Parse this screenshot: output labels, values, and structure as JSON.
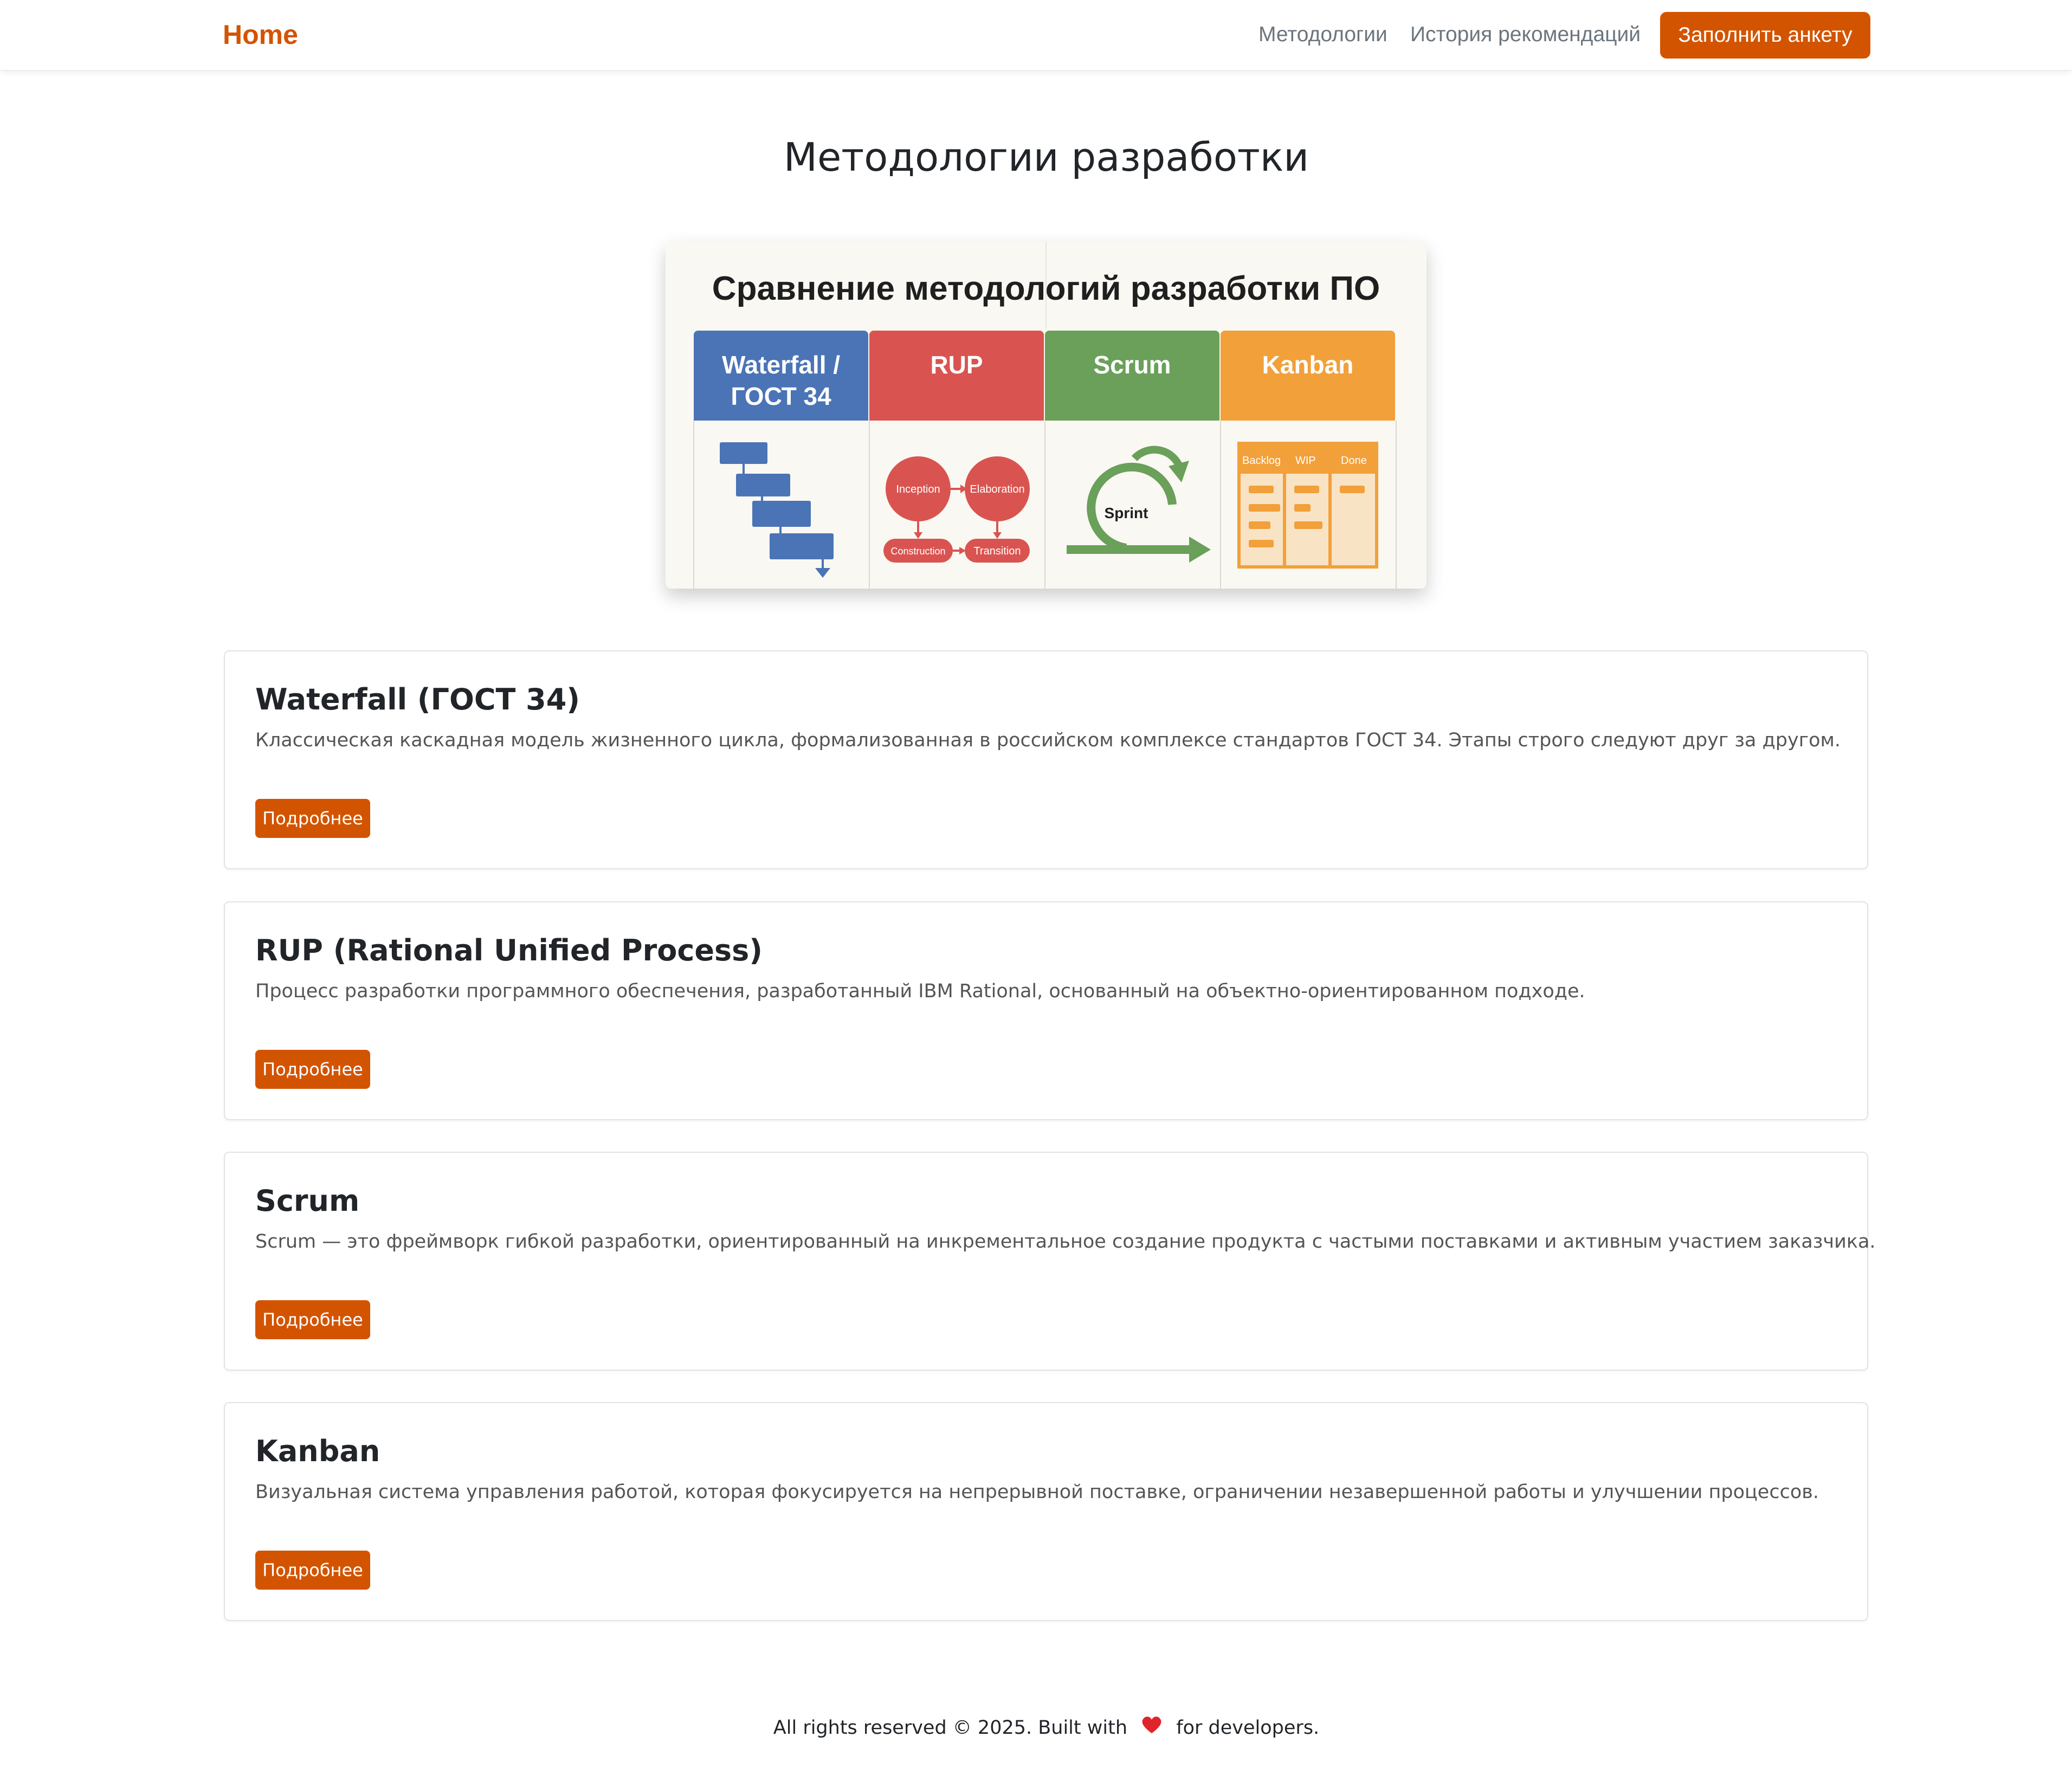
{
  "navbar": {
    "brand": "Home",
    "links": [
      "Методологии",
      "История рекомендаций"
    ],
    "cta": "Заполнить анкету",
    "accent_color": "#d35400"
  },
  "page": {
    "title": "Методологии разработки"
  },
  "hero": {
    "title": "Сравнение методологий разработки ПО",
    "columns": [
      {
        "label": "Waterfall / ГОСТ 34",
        "color": "#4a74b5"
      },
      {
        "label": "RUP",
        "color": "#d95450"
      },
      {
        "label": "Scrum",
        "color": "#6aa05a"
      },
      {
        "label": "Kanban",
        "color": "#f2a03a"
      }
    ],
    "rup_phases": [
      "Inception",
      "Elaboration",
      "Construction",
      "Transition"
    ],
    "scrum_label": "Sprint",
    "kanban_columns": [
      "Backlog",
      "WIP",
      "Done"
    ]
  },
  "cards": [
    {
      "title": "Waterfall (ГОСТ 34)",
      "text": "Классическая каскадная модель жизненного цикла, формализованная в российском комплексе стандартов ГОСТ 34. Этапы строго следуют друг за другом.",
      "button": "Подробнее"
    },
    {
      "title": "RUP (Rational Unified Process)",
      "text": "Процесс разработки программного обеспечения, разработанный IBM Rational, основанный на объектно-ориентированном подходе.",
      "button": "Подробнее"
    },
    {
      "title": "Scrum",
      "text": "Scrum — это фреймворк гибкой разработки, ориентированный на инкрементальное создание продукта с частыми поставками и активным участием заказчика.",
      "button": "Подробнее"
    },
    {
      "title": "Kanban",
      "text": "Визуальная система управления работой, которая фокусируется на непрерывной поставке, ограничении незавершенной работы и улучшении процессов.",
      "button": "Подробнее"
    }
  ],
  "footer": {
    "text_before": "All rights reserved © 2025. Built with",
    "icon": "heart-icon",
    "text_after": "for developers."
  }
}
